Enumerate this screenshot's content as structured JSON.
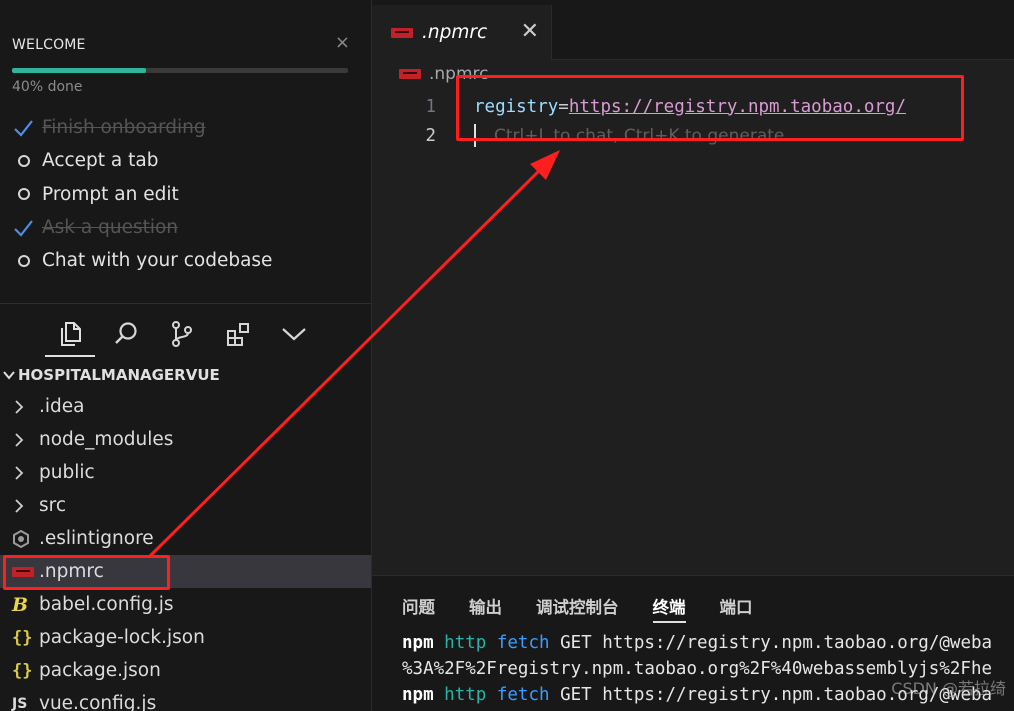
{
  "welcome": {
    "title": "WELCOME",
    "close": "×",
    "progress_percent": 40,
    "progress_label": "40% done",
    "tasks": [
      {
        "label": "Finish onboarding",
        "done": true
      },
      {
        "label": "Accept a tab",
        "done": false
      },
      {
        "label": "Prompt an edit",
        "done": false
      },
      {
        "label": "Ask a question",
        "done": true
      },
      {
        "label": "Chat with your codebase",
        "done": false
      }
    ]
  },
  "activity_bar": [
    "files-icon",
    "search-icon",
    "source-control-icon",
    "extensions-icon",
    "chevron-down-icon"
  ],
  "explorer": {
    "project": "HOSPITALMANAGERVUE",
    "items": [
      {
        "label": ".idea",
        "icon": "chevron-right-icon"
      },
      {
        "label": "node_modules",
        "icon": "chevron-right-icon"
      },
      {
        "label": "public",
        "icon": "chevron-right-icon"
      },
      {
        "label": "src",
        "icon": "chevron-right-icon"
      },
      {
        "label": ".eslintignore",
        "icon": "eslint-file-icon"
      },
      {
        "label": ".npmrc",
        "icon": "npm-file-icon"
      },
      {
        "label": "babel.config.js",
        "icon": "babel-file-icon"
      },
      {
        "label": "package-lock.json",
        "icon": "json-file-icon"
      },
      {
        "label": "package.json",
        "icon": "json-file-icon"
      },
      {
        "label": "vue.config.js",
        "icon": "js-file-icon"
      }
    ]
  },
  "editor": {
    "tab_label": ".npmrc",
    "tab_close": "✕",
    "breadcrumb": ".npmrc",
    "line_numbers": [
      "1",
      "2"
    ],
    "line1_key": "registry",
    "line1_eq": "=",
    "line1_value": "https://registry.npm.taobao.org/",
    "line2_hint": "Ctrl+L to chat, Ctrl+K to generate"
  },
  "panel": {
    "tabs": [
      "问题",
      "输出",
      "调试控制台",
      "终端",
      "端口"
    ],
    "active_tab": "终端",
    "terminal_lines": [
      {
        "npm": "npm",
        "http": "http",
        "fetch": "fetch",
        "rest": " GET https://registry.npm.taobao.org/@weba"
      },
      {
        "text": "%3A%2F%2Fregistry.npm.taobao.org%2F%40webassemblyjs%2Fhe"
      },
      {
        "npm": "npm",
        "http": "http",
        "fetch": "fetch",
        "rest": " GET https://registry.npm.taobao.org/@weba"
      }
    ],
    "watermark": "CSDN @若拉绮"
  },
  "colors": {
    "accent": "#2fb59a",
    "annotation_red": "#ff1f1f",
    "npm_red": "#c12127"
  }
}
